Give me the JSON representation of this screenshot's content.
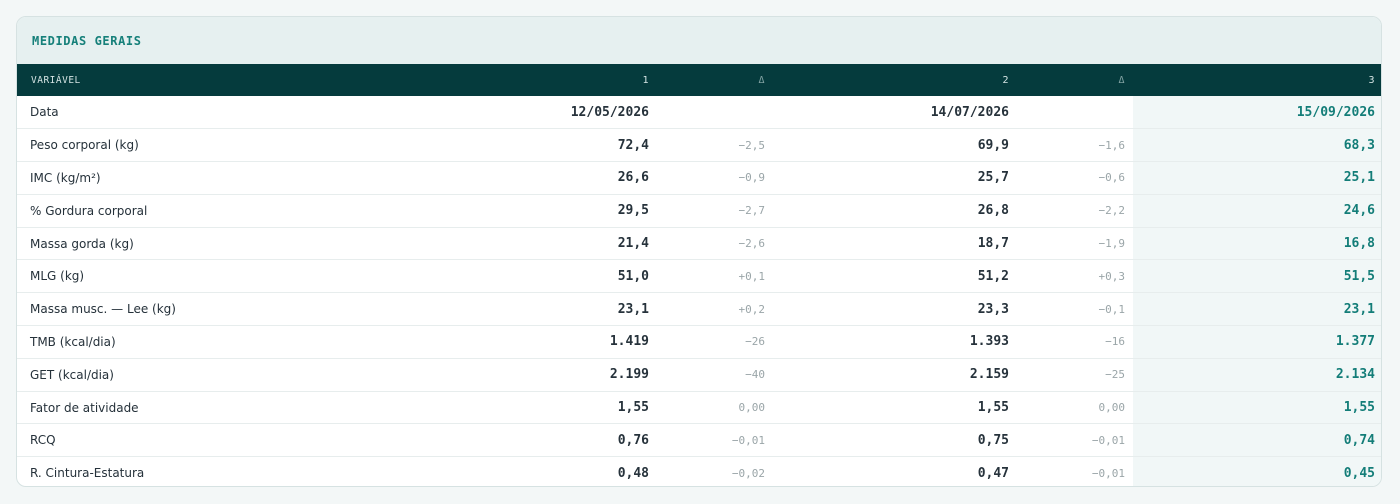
{
  "section": {
    "title": "MEDIDAS GERAIS"
  },
  "columns": {
    "variable": "VARIÁVEL",
    "c1": "1",
    "d1": "Δ",
    "c2": "2",
    "d2": "Δ",
    "c3": "3"
  },
  "colors": {
    "header_bg": "#053b3d",
    "accent": "#137d78",
    "section_bg": "#e6f0f0"
  },
  "rows": [
    {
      "label": "Data",
      "v1": "12/05/2026",
      "d1": "",
      "v2": "14/07/2026",
      "d2": "",
      "v3": "15/09/2026"
    },
    {
      "label": "Peso corporal (kg)",
      "v1": "72,4",
      "d1": "−2,5",
      "v2": "69,9",
      "d2": "−1,6",
      "v3": "68,3"
    },
    {
      "label": "IMC (kg/m²)",
      "v1": "26,6",
      "d1": "−0,9",
      "v2": "25,7",
      "d2": "−0,6",
      "v3": "25,1"
    },
    {
      "label": "% Gordura corporal",
      "v1": "29,5",
      "d1": "−2,7",
      "v2": "26,8",
      "d2": "−2,2",
      "v3": "24,6"
    },
    {
      "label": "Massa gorda (kg)",
      "v1": "21,4",
      "d1": "−2,6",
      "v2": "18,7",
      "d2": "−1,9",
      "v3": "16,8"
    },
    {
      "label": "MLG (kg)",
      "v1": "51,0",
      "d1": "+0,1",
      "v2": "51,2",
      "d2": "+0,3",
      "v3": "51,5"
    },
    {
      "label": "Massa musc. — Lee (kg)",
      "v1": "23,1",
      "d1": "+0,2",
      "v2": "23,3",
      "d2": "−0,1",
      "v3": "23,1"
    },
    {
      "label": "TMB (kcal/dia)",
      "v1": "1.419",
      "d1": "−26",
      "v2": "1.393",
      "d2": "−16",
      "v3": "1.377"
    },
    {
      "label": "GET (kcal/dia)",
      "v1": "2.199",
      "d1": "−40",
      "v2": "2.159",
      "d2": "−25",
      "v3": "2.134"
    },
    {
      "label": "Fator de atividade",
      "v1": "1,55",
      "d1": "0,00",
      "v2": "1,55",
      "d2": "0,00",
      "v3": "1,55"
    },
    {
      "label": "RCQ",
      "v1": "0,76",
      "d1": "−0,01",
      "v2": "0,75",
      "d2": "−0,01",
      "v3": "0,74"
    },
    {
      "label": "R. Cintura-Estatura",
      "v1": "0,48",
      "d1": "−0,02",
      "v2": "0,47",
      "d2": "−0,01",
      "v3": "0,45"
    }
  ]
}
